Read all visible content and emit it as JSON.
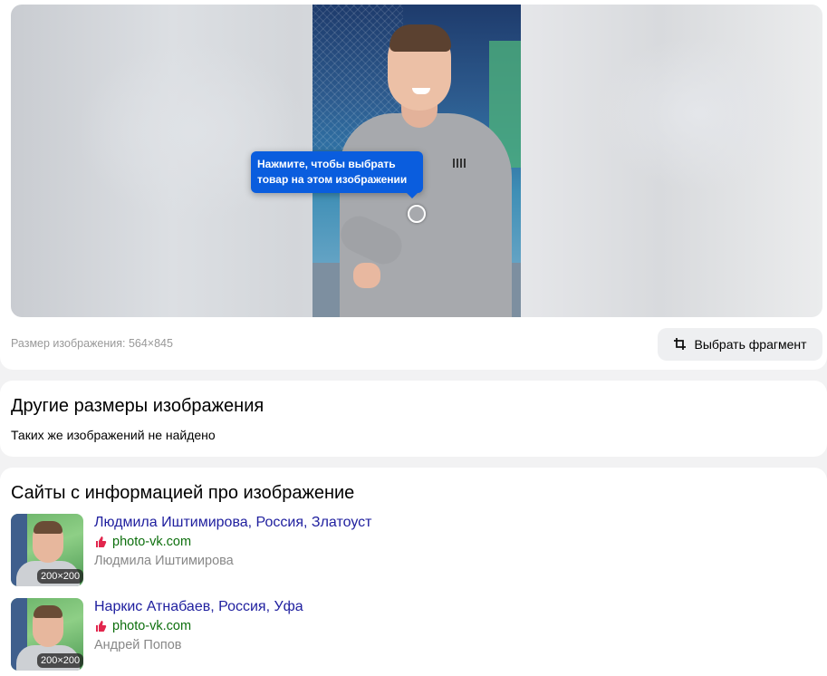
{
  "viewer": {
    "tooltip_line1": "Нажмите, чтобы выбрать",
    "tooltip_line2": "товар на этом изображении"
  },
  "image_info": {
    "size_label": "Размер изображения: 564×845",
    "fragment_button_label": "Выбрать фрагмент"
  },
  "other_sizes": {
    "title": "Другие размеры изображения",
    "message": "Таких же изображений не найдено"
  },
  "sites": {
    "title": "Сайты с информацией про изображение",
    "results": [
      {
        "title": "Людмила Иштимирова, Россия, Златоуст",
        "site": "photo-vk.com",
        "author": "Людмила Иштимирова",
        "thumb_size": "200×200"
      },
      {
        "title": "Наркис Атнабаев, Россия, Уфа",
        "site": "photo-vk.com",
        "author": "Андрей Попов",
        "thumb_size": "200×200"
      }
    ]
  }
}
